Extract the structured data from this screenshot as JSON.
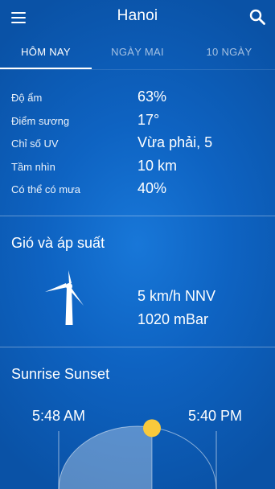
{
  "header": {
    "menu_icon": "hamburger-menu-icon",
    "title": "Hanoi",
    "search_icon": "search-icon"
  },
  "tabs": [
    {
      "label": "HÔM NAY",
      "active": true
    },
    {
      "label": "NGÀY MAI",
      "active": false
    },
    {
      "label": "10 NGÀY",
      "active": false
    }
  ],
  "details": [
    {
      "label": "Độ ẩm",
      "value": "63%"
    },
    {
      "label": "Điểm sương",
      "value": "17°"
    },
    {
      "label": "Chỉ số UV",
      "value": "Vừa phải, 5"
    },
    {
      "label": "Tầm nhìn",
      "value": "10 km"
    },
    {
      "label": "Có thể có mưa",
      "value": "40%"
    }
  ],
  "wind": {
    "title": "Gió và áp suất",
    "icon": "wind-turbine-icon",
    "speed": "5 km/h NNV",
    "pressure": "1020 mBar"
  },
  "sun": {
    "title": "Sunrise Sunset",
    "sunrise": "5:48 AM",
    "sunset": "5:40 PM",
    "icon": "sun-icon",
    "day_progress": 0.5,
    "sun_color": "#f9c93c"
  },
  "colors": {
    "background": "#0e63c2",
    "accent": "#ffffff"
  }
}
